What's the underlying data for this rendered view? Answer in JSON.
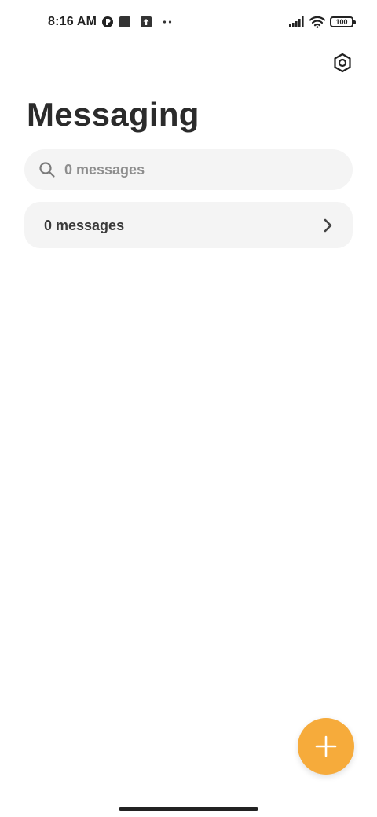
{
  "status_bar": {
    "time": "8:16 AM",
    "battery": "100",
    "icons": [
      "app-notification-icon",
      "square-notification-icon",
      "upload-notification-icon",
      "more-dots-icon",
      "signal-icon",
      "wifi-icon",
      "battery-icon"
    ]
  },
  "header": {
    "title": "Messaging",
    "settings_icon": "settings-hexagon-icon"
  },
  "search": {
    "placeholder": "0 messages",
    "icon": "search-icon"
  },
  "conversations_row": {
    "label": "0 messages",
    "icon": "chevron-right-icon"
  },
  "fab": {
    "icon": "plus-icon",
    "color": "#f6ab3b"
  },
  "colors": {
    "background": "#ffffff",
    "surface": "#f4f4f4",
    "accent": "#f6ab3b",
    "text_primary": "#2b2b2b",
    "text_secondary": "#8e8e8e"
  }
}
